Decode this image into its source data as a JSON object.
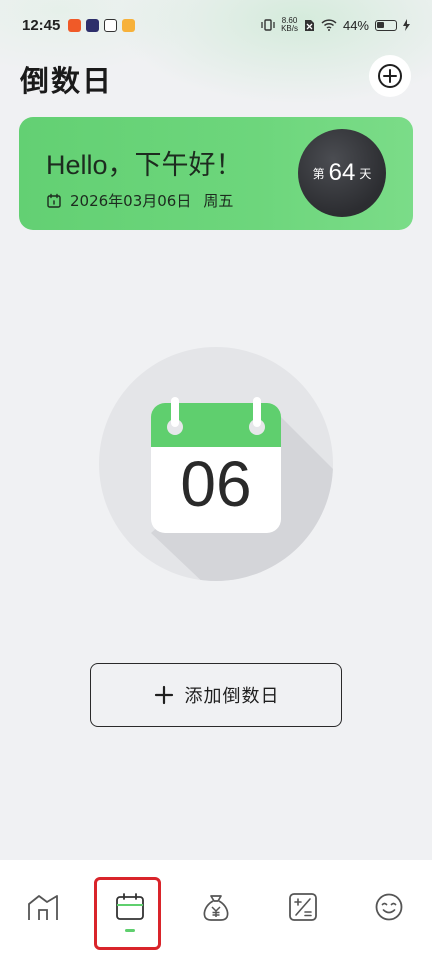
{
  "status_bar": {
    "time": "12:45",
    "net_speed_value": "8.60",
    "net_speed_unit": "KB/s",
    "battery": "44%",
    "battery_level": 0.44
  },
  "header": {
    "title": "倒数日"
  },
  "greeting": {
    "text": "Hello，下午好！",
    "date": "2026年03月06日",
    "weekday": "周五",
    "day_prefix": "第",
    "day_number": "64",
    "day_suffix": "天"
  },
  "illustration": {
    "day": "06"
  },
  "actions": {
    "add_label": "添加倒数日"
  },
  "bottom_nav": [
    {
      "icon": "home-icon",
      "active": false
    },
    {
      "icon": "calendar-icon",
      "active": true
    },
    {
      "icon": "money-bag-icon",
      "active": false
    },
    {
      "icon": "calculator-icon",
      "active": false
    },
    {
      "icon": "smile-icon",
      "active": false
    }
  ],
  "colors": {
    "accent": "#5fcf6e",
    "card": "#6dd67c",
    "badge": "#333438",
    "highlight": "#d9242a"
  }
}
